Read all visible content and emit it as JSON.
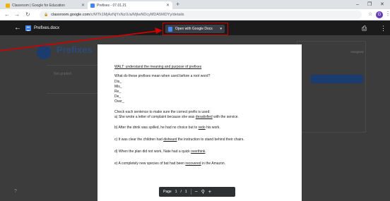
{
  "browser": {
    "tabs": [
      {
        "label": "Classroom | Google for Education",
        "favicon_color": "#f4b400"
      },
      {
        "label": "Prefixes - 07.01.21",
        "favicon_color": "#4285f4"
      }
    ],
    "new_tab": "+",
    "window_controls": [
      "–",
      "❐",
      "✕"
    ],
    "url_host": "classroom.google.com",
    "url_path": "/c/MTk1MjAzNjYxNzI1/a/MjIwNDcyMDA5MDYy/details",
    "profile_initial": "G"
  },
  "background_page": {
    "title": "Prefixes",
    "subtitle": "",
    "card1": "Not graded",
    "card2": "",
    "right_label": "Assigned",
    "right_text": "",
    "right_button": "",
    "help": "?"
  },
  "viewer": {
    "filename": "Prefixes.docx",
    "open_button": "Open with Google Docs"
  },
  "document": {
    "heading_walt": "WALT:",
    "heading_rest": " understand the meaning and purpose of prefixes",
    "question": "What do these prefixes mean when used before a root word?",
    "prefixes": [
      "Dis_",
      "Mis_",
      "Re_",
      "De_",
      "Over_"
    ],
    "instruction": "Check each sentence to make sure the correct prefix is used:",
    "sentences": [
      {
        "pre": "a) She wrote a letter of complaint because she was ",
        "word": "desatisfied",
        "post": " with the service."
      },
      {
        "pre": "b) After the drink was spilled, he had no choice but to ",
        "word": "redo",
        "post": " his work."
      },
      {
        "pre": "c) It was clear the children had ",
        "word": "disheard",
        "post": " the instruction to stand behind their chairs."
      },
      {
        "pre": "d) When the plan did not work, Nate had a quick ",
        "word": "overthink",
        "post": "."
      },
      {
        "pre": "e) A completely new species of bat had been ",
        "word": "recovered",
        "post": " in the Amazon."
      }
    ]
  },
  "pager": {
    "label": "Page",
    "current": "1",
    "slash": "/",
    "total": "1"
  }
}
